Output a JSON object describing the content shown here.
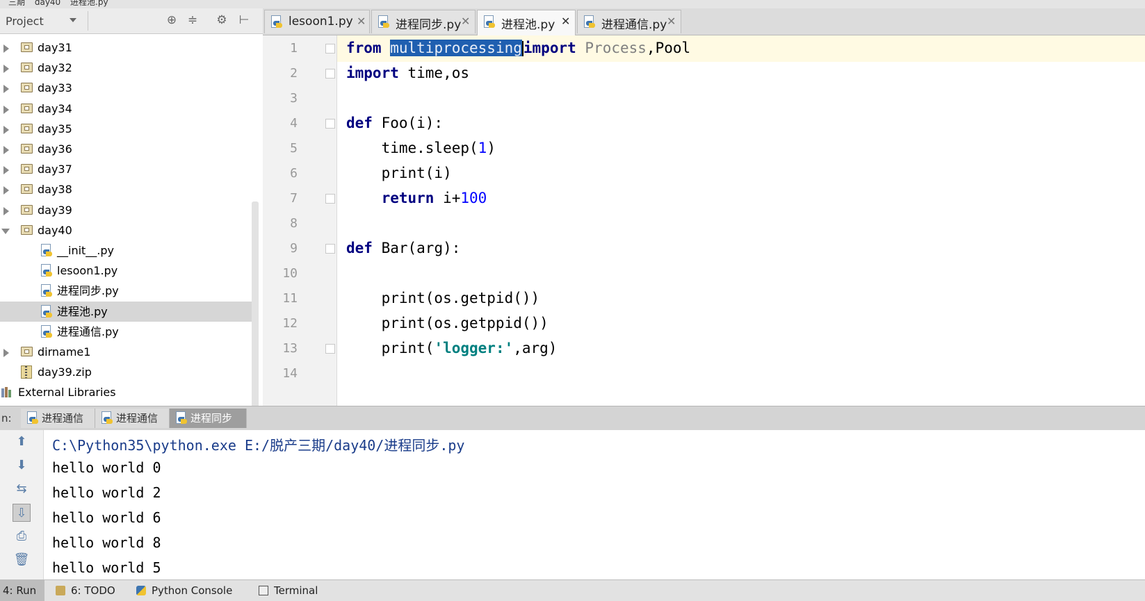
{
  "breadcrumb": [
    "三期",
    "day40",
    "进程池.py"
  ],
  "project": {
    "title": "Project",
    "tree": [
      {
        "label": "day31",
        "type": "folder",
        "indent": 0,
        "expanded": false
      },
      {
        "label": "day32",
        "type": "folder",
        "indent": 0,
        "expanded": false
      },
      {
        "label": "day33",
        "type": "folder",
        "indent": 0,
        "expanded": false
      },
      {
        "label": "day34",
        "type": "folder",
        "indent": 0,
        "expanded": false
      },
      {
        "label": "day35",
        "type": "folder",
        "indent": 0,
        "expanded": false
      },
      {
        "label": "day36",
        "type": "folder",
        "indent": 0,
        "expanded": false
      },
      {
        "label": "day37",
        "type": "folder",
        "indent": 0,
        "expanded": false
      },
      {
        "label": "day38",
        "type": "folder",
        "indent": 0,
        "expanded": false
      },
      {
        "label": "day39",
        "type": "folder",
        "indent": 0,
        "expanded": false
      },
      {
        "label": "day40",
        "type": "folder",
        "indent": 0,
        "expanded": true
      },
      {
        "label": "__init__.py",
        "type": "py",
        "indent": 1
      },
      {
        "label": "lesoon1.py",
        "type": "py",
        "indent": 1
      },
      {
        "label": "进程同步.py",
        "type": "py",
        "indent": 1
      },
      {
        "label": "进程池.py",
        "type": "py",
        "indent": 1,
        "selected": true
      },
      {
        "label": "进程通信.py",
        "type": "py",
        "indent": 1
      },
      {
        "label": "dirname1",
        "type": "folder",
        "indent": 0,
        "expanded": false
      },
      {
        "label": "day39.zip",
        "type": "zip",
        "indent": 0
      },
      {
        "label": "External Libraries",
        "type": "lib",
        "indent": 0
      }
    ]
  },
  "tabs": [
    {
      "label": "lesoon1.py",
      "active": false
    },
    {
      "label": "进程同步.py",
      "active": false
    },
    {
      "label": "进程池.py",
      "active": true
    },
    {
      "label": "进程通信.py",
      "active": false
    }
  ],
  "editor": {
    "line_numbers": [
      "1",
      "2",
      "3",
      "4",
      "5",
      "6",
      "7",
      "8",
      "9",
      "10",
      "11",
      "12",
      "13",
      "14"
    ],
    "code": {
      "l1_from": "from",
      "l1_mod": "multiprocessing",
      "l1_import": "import",
      "l1_proc": "Process",
      "l1_rest": ",Pool",
      "l2_import": "import",
      "l2_rest": " time,os",
      "l4_def": "def",
      "l4_rest": " Foo(i):",
      "l5_a": "    time.sleep(",
      "l5_num": "1",
      "l5_b": ")",
      "l6": "    print(i)",
      "l7_ret": "    return",
      "l7_a": " i+",
      "l7_num": "100",
      "l9_def": "def",
      "l9_rest": " Bar(arg):",
      "l11": "    print(os.getpid())",
      "l12": "    print(os.getppid())",
      "l13_a": "    print(",
      "l13_str": "'logger:'",
      "l13_b": ",arg)"
    }
  },
  "run": {
    "prefix": "n:",
    "tabs": [
      {
        "label": "进程通信",
        "active": false
      },
      {
        "label": "进程通信",
        "active": false
      },
      {
        "label": "进程同步",
        "active": true
      }
    ]
  },
  "console": {
    "lines": [
      "C:\\Python35\\python.exe E:/脱产三期/day40/进程同步.py",
      "hello world 0",
      "hello world 2",
      "hello world 6",
      "hello world 8",
      "hello world 5"
    ]
  },
  "statusbar": {
    "run": "4: Run",
    "todo": "6: TODO",
    "python_console": "Python Console",
    "terminal": "Terminal"
  }
}
